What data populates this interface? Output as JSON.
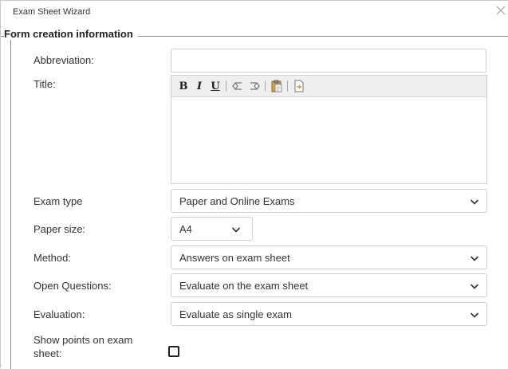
{
  "window": {
    "title": "Exam Sheet Wizard"
  },
  "section": {
    "legend": "Form creation information"
  },
  "fields": {
    "abbreviation": {
      "label": "Abbreviation:",
      "value": ""
    },
    "title": {
      "label": "Title:",
      "toolbar": {
        "bold": "B",
        "italic": "I",
        "underline": "U"
      },
      "value": ""
    },
    "exam_type": {
      "label": "Exam type",
      "value": "Paper and Online Exams"
    },
    "paper_size": {
      "label": "Paper size:",
      "value": "A4"
    },
    "method": {
      "label": "Method:",
      "value": "Answers on exam sheet"
    },
    "open_questions": {
      "label": "Open Questions:",
      "value": "Evaluate on the exam sheet"
    },
    "evaluation": {
      "label": "Evaluation:",
      "value": "Evaluate as single exam"
    },
    "show_points": {
      "label_line1": "Show points on exam",
      "label_line2": "sheet:",
      "checked": false
    }
  },
  "icons": [
    "close-icon",
    "undo-icon",
    "redo-icon",
    "paste-icon",
    "insert-icon",
    "chevron-down-icon",
    "checkbox-icon"
  ]
}
